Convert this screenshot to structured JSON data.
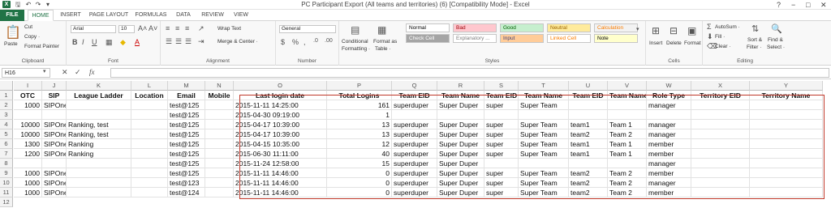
{
  "window": {
    "title": "PC Participant Export (All teams and territories) (6)  [Compatibility Mode] - Excel",
    "controls": [
      "?",
      "−",
      "□",
      "✕"
    ]
  },
  "app_icon": "X",
  "tabs": [
    "FILE",
    "HOME",
    "INSERT",
    "PAGE LAYOUT",
    "FORMULAS",
    "DATA",
    "REVIEW",
    "VIEW"
  ],
  "ribbon": {
    "clipboard": {
      "paste": "Paste",
      "cut": "Cut",
      "copy": "Copy ·",
      "format_painter": "Format Painter",
      "label": "Clipboard"
    },
    "font": {
      "name": "Arial",
      "size": "10",
      "label": "Font"
    },
    "alignment": {
      "wrap": "Wrap Text",
      "merge": "Merge & Center ·",
      "label": "Alignment"
    },
    "number": {
      "format": "General",
      "label": "Number"
    },
    "styles": {
      "conditional": "Conditional",
      "conditional2": "Formatting ·",
      "format_as": "Format as",
      "format_as2": "Table ·",
      "cells": [
        {
          "name": "Normal",
          "bg": "#ffffff",
          "fg": "#000000"
        },
        {
          "name": "Bad",
          "bg": "#ffc7ce",
          "fg": "#9c0006"
        },
        {
          "name": "Good",
          "bg": "#c6efce",
          "fg": "#006100"
        },
        {
          "name": "Neutral",
          "bg": "#ffeb9c",
          "fg": "#9c6500"
        },
        {
          "name": "Calculation",
          "bg": "#f2f2f2",
          "fg": "#fa7d00"
        },
        {
          "name": "Check Cell",
          "bg": "#a5a5a5",
          "fg": "#ffffff"
        },
        {
          "name": "Explanatory ...",
          "bg": "#ffffff",
          "fg": "#7f7f7f"
        },
        {
          "name": "Input",
          "bg": "#ffcc99",
          "fg": "#3f3f76"
        },
        {
          "name": "Linked Cell",
          "bg": "#ffffff",
          "fg": "#fa7d00"
        },
        {
          "name": "Note",
          "bg": "#ffffcc",
          "fg": "#000000"
        }
      ],
      "label": "Styles"
    },
    "cells": {
      "insert": "Insert",
      "delete": "Delete",
      "format": "Format",
      "label": "Cells"
    },
    "editing": {
      "autosum": "AutoSum ·",
      "fill": "Fill ·",
      "clear": "Clear ·",
      "sort": "Sort &",
      "sort2": "Filter ·",
      "find": "Find &",
      "find2": "Select ·",
      "label": "Editing"
    }
  },
  "formula_bar": {
    "name_box": "H16",
    "fx": "fx",
    "value": ""
  },
  "columns": [
    "I",
    "J",
    "K",
    "L",
    "M",
    "N",
    "O",
    "P",
    "Q",
    "R",
    "S",
    "T",
    "U",
    "V",
    "W",
    "X",
    "Y"
  ],
  "rows": [
    [
      "OTC",
      "SIP",
      "League Ladder",
      "Location",
      "Email",
      "Mobile",
      "Last login date",
      "Total Logins",
      "Team EID",
      "Team Name",
      "Team EID",
      "Team Name",
      "Team EID",
      "Team Name",
      "Role Type",
      "Territory EID",
      "Territory Name"
    ],
    [
      "1000",
      "SIPOne",
      "",
      "",
      "test@125",
      "",
      "2015-11-11 14:25:00",
      "161",
      "superduper",
      "Super Duper",
      "super",
      "Super Team",
      "",
      "",
      "manager",
      "",
      ""
    ],
    [
      "",
      "",
      "",
      "",
      "test@125",
      "",
      "2015-04-30 09:19:00",
      "1",
      "",
      "",
      "",
      "",
      "",
      "",
      "",
      "",
      ""
    ],
    [
      "10000",
      "SIPOne",
      "Ranking, test",
      "",
      "test@125",
      "",
      "2015-04-17 10:39:00",
      "13",
      "superduper",
      "Super Duper",
      "super",
      "Super Team",
      "team1",
      "Team 1",
      "manager",
      "",
      ""
    ],
    [
      "10000",
      "SIPOne",
      "Ranking, test",
      "",
      "test@125",
      "",
      "2015-04-17 10:39:00",
      "13",
      "superduper",
      "Super Duper",
      "super",
      "Super Team",
      "team2",
      "Team 2",
      "manager",
      "",
      ""
    ],
    [
      "1300",
      "SIPOne",
      "Ranking",
      "",
      "test@125",
      "",
      "2015-04-15 10:35:00",
      "12",
      "superduper",
      "Super Duper",
      "super",
      "Super Team",
      "team1",
      "Team 1",
      "member",
      "",
      ""
    ],
    [
      "1200",
      "SIPOne",
      "Ranking",
      "",
      "test@125",
      "",
      "2015-06-30 11:11:00",
      "40",
      "superduper",
      "Super Duper",
      "super",
      "Super Team",
      "team1",
      "Team 1",
      "member",
      "",
      ""
    ],
    [
      "",
      "",
      "",
      "",
      "test@125",
      "",
      "2015-11-24 12:58:00",
      "15",
      "superduper",
      "Super Duper",
      "",
      "",
      "",
      "",
      "manager",
      "",
      ""
    ],
    [
      "1000",
      "SIPOne",
      "",
      "",
      "test@125",
      "",
      "2015-11-11 14:46:00",
      "0",
      "superduper",
      "Super Duper",
      "super",
      "Super Team",
      "team2",
      "Team 2",
      "member",
      "",
      ""
    ],
    [
      "1000",
      "SIPOne",
      "",
      "",
      "test@123",
      "",
      "2015-11-11 14:46:00",
      "0",
      "superduper",
      "Super Duper",
      "super",
      "Super Team",
      "team2",
      "Team 2",
      "manager",
      "",
      ""
    ],
    [
      "1000",
      "SIPOne",
      "",
      "",
      "test@124",
      "",
      "2015-11-11 14:46:00",
      "0",
      "superduper",
      "Super Duper",
      "super",
      "Super Team",
      "team2",
      "Team 2",
      "member",
      "",
      ""
    ]
  ],
  "highlight_color": "#c0392b"
}
